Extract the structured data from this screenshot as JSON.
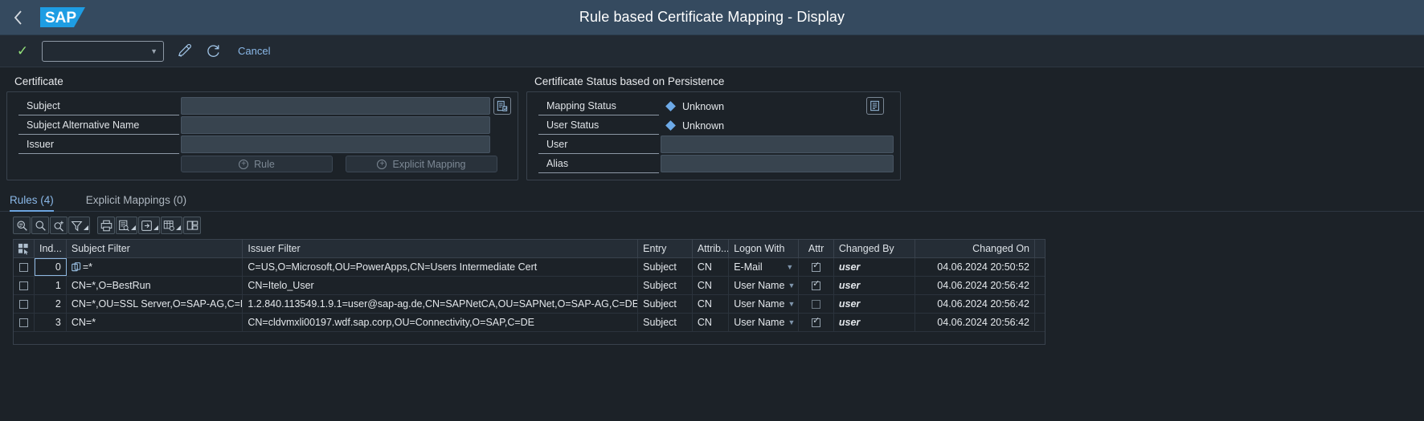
{
  "header": {
    "back_icon": "chevron-left-icon",
    "logo_text": "SAP",
    "title": "Rule based Certificate Mapping - Display"
  },
  "action_bar": {
    "confirm_icon": "check-icon",
    "select_value": "",
    "select_placeholder": "",
    "edit_icon": "edit-pencil-icon",
    "refresh_icon": "refresh-icon",
    "cancel_label": "Cancel"
  },
  "certificate_panel": {
    "title": "Certificate",
    "fields": [
      {
        "label": "Subject",
        "value": ""
      },
      {
        "label": "Subject Alternative Name",
        "value": ""
      },
      {
        "label": "Issuer",
        "value": ""
      }
    ],
    "value_help_icon": "value-help-icon",
    "buttons": [
      {
        "label": "Rule",
        "icon": "plus-circle-icon"
      },
      {
        "label": "Explicit Mapping",
        "icon": "plus-circle-icon"
      }
    ]
  },
  "status_panel": {
    "title": "Certificate Status based on Persistence",
    "statuses": [
      {
        "label": "Mapping Status",
        "value": "Unknown",
        "indicator": "diamond-icon",
        "indicator_color": "#6daae8"
      },
      {
        "label": "User Status",
        "value": "Unknown",
        "indicator": "diamond-icon",
        "indicator_color": "#6daae8"
      }
    ],
    "fields": [
      {
        "label": "User",
        "value": ""
      },
      {
        "label": "Alias",
        "value": ""
      }
    ],
    "value_help_icon": "user-value-help-icon"
  },
  "tabs": [
    {
      "label": "Rules (4)",
      "active": true
    },
    {
      "label": "Explicit Mappings (0)",
      "active": false
    }
  ],
  "table_toolbar": [
    {
      "icon": "search-detail-icon",
      "split": false
    },
    {
      "icon": "search-icon",
      "split": false
    },
    {
      "icon": "search-plus-icon",
      "split": false
    },
    {
      "icon": "filter-icon",
      "split": true
    },
    {
      "icon": "print-icon",
      "split": false
    },
    {
      "icon": "report-icon",
      "split": true
    },
    {
      "icon": "export-icon",
      "split": true
    },
    {
      "icon": "table-settings-icon",
      "split": true
    },
    {
      "icon": "layout-icon",
      "split": false
    }
  ],
  "table": {
    "columns": [
      {
        "key": "select",
        "label": "",
        "icon": "select-all-icon"
      },
      {
        "key": "ind",
        "label": "Ind..."
      },
      {
        "key": "subject_filter",
        "label": "Subject Filter"
      },
      {
        "key": "issuer_filter",
        "label": "Issuer Filter"
      },
      {
        "key": "entry",
        "label": "Entry"
      },
      {
        "key": "attrib",
        "label": "Attrib..."
      },
      {
        "key": "logon_with",
        "label": "Logon With"
      },
      {
        "key": "attr",
        "label": "Attr"
      },
      {
        "key": "changed_by",
        "label": "Changed By"
      },
      {
        "key": "changed_on",
        "label": "Changed On"
      }
    ],
    "rows": [
      {
        "selected": false,
        "ind": "0",
        "subject_filter": "=*",
        "subject_prefix_icon": "copy-icon",
        "issuer_filter": "C=US,O=Microsoft,OU=PowerApps,CN=Users Intermediate Cert",
        "entry": "Subject",
        "attrib": "CN",
        "logon_with": "E-Mail",
        "attr": true,
        "changed_by": "user",
        "changed_on": "04.06.2024 20:50:52",
        "focused": true
      },
      {
        "selected": false,
        "ind": "1",
        "subject_filter": "CN=*,O=BestRun",
        "issuer_filter": "CN=Itelo_User",
        "entry": "Subject",
        "attrib": "CN",
        "logon_with": "User Name",
        "attr": true,
        "changed_by": "user",
        "changed_on": "04.06.2024 20:56:42",
        "focused": false
      },
      {
        "selected": false,
        "ind": "2",
        "subject_filter": "CN=*,OU=SSL Server,O=SAP-AG,C=DE",
        "issuer_filter": "1.2.840.113549.1.9.1=user@sap-ag.de,CN=SAPNetCA,OU=SAPNet,O=SAP-AG,C=DE",
        "entry": "Subject",
        "attrib": "CN",
        "logon_with": "User Name",
        "attr": false,
        "changed_by": "user",
        "changed_on": "04.06.2024 20:56:42",
        "focused": false
      },
      {
        "selected": false,
        "ind": "3",
        "subject_filter": "CN=*",
        "issuer_filter": "CN=cldvmxli00197.wdf.sap.corp,OU=Connectivity,O=SAP,C=DE",
        "entry": "Subject",
        "attrib": "CN",
        "logon_with": "User Name",
        "attr": true,
        "changed_by": "user",
        "changed_on": "04.06.2024 20:56:42",
        "focused": false
      }
    ]
  },
  "colors": {
    "shell_bg": "#354a5f",
    "page_bg": "#1c2228",
    "accent": "#6da5e0",
    "link": "#8ab8e8",
    "confirm": "#93e07a",
    "sap_blue": "#1e9de3"
  }
}
